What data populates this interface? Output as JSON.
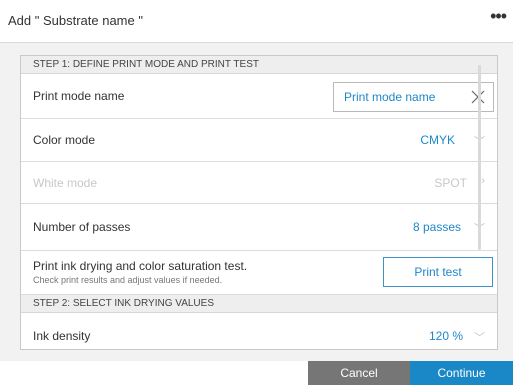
{
  "window": {
    "title": "Add \" Substrate name \"",
    "menu_icon": "more-dots-icon"
  },
  "step1": {
    "header": "STEP 1: DEFINE PRINT MODE AND PRINT TEST"
  },
  "rows": {
    "print_mode": {
      "label": "Print mode name",
      "input_placeholder": "Print mode name",
      "clear_icon": "close-icon"
    },
    "color_mode": {
      "label": "Color mode",
      "value": "CMYK"
    },
    "white_mode": {
      "label": "White mode",
      "value": "SPOT"
    },
    "passes": {
      "label": "Number of passes",
      "value": "8 passes"
    },
    "test": {
      "title": "Print ink drying and color saturation test.",
      "note": "Check print results and adjust values if needed.",
      "button": "Print test"
    }
  },
  "step2": {
    "header": "STEP 2: SELECT INK DRYING VALUES"
  },
  "ink_density": {
    "label": "Ink density",
    "value": "120 %"
  },
  "footer": {
    "cancel": "Cancel",
    "continue": "Continue"
  },
  "colors": {
    "accent": "#1a87c6",
    "cancel_bg": "#767676",
    "panel_bg": "#f2f2f2"
  }
}
